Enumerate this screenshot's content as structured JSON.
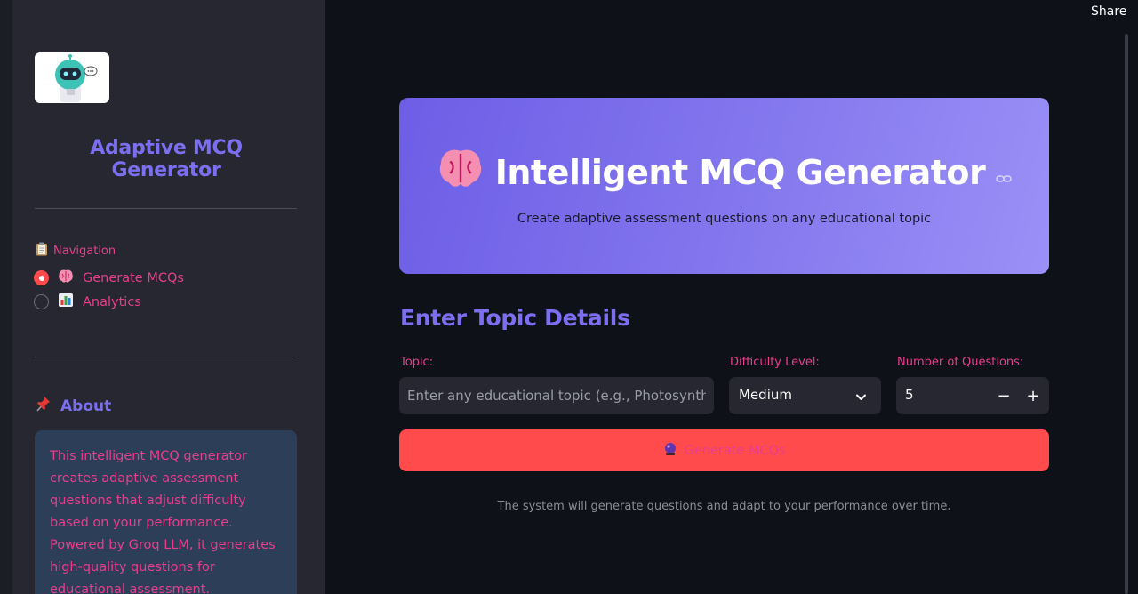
{
  "sidebar": {
    "title": "Adaptive MCQ Generator",
    "nav_label": "Navigation",
    "nav_items": [
      {
        "label": "Generate MCQs",
        "selected": true
      },
      {
        "label": "Analytics",
        "selected": false
      }
    ],
    "about_heading": "About",
    "about_text": "This intelligent MCQ generator creates adaptive assessment questions that adjust difficulty based on your performance. Powered by Groq LLM, it generates high-quality questions for educational assessment."
  },
  "header": {
    "share_label": "Share"
  },
  "hero": {
    "title": "Intelligent MCQ Generator",
    "subtitle": "Create adaptive assessment questions on any educational topic"
  },
  "form": {
    "section_title": "Enter Topic Details",
    "topic_label": "Topic:",
    "topic_placeholder": "Enter any educational topic (e.g., Photosynthesis, World War II, Calculus)",
    "topic_value": "",
    "difficulty_label": "Difficulty Level:",
    "difficulty_value": "Medium",
    "count_label": "Number of Questions:",
    "count_value": "5",
    "decrement": "−",
    "increment": "+",
    "generate_label": "Generate MCQs",
    "hint": "The system will generate questions and adapt to your performance over time."
  },
  "colors": {
    "accent": "#7b6ff0",
    "primary_button": "#ff4b4b",
    "label_pink": "#e83e8c",
    "background": "#0e1117",
    "sidebar": "#262730"
  },
  "icons": {
    "hero": "brain-icon",
    "nav_generate": "brain-icon",
    "nav_analytics": "bar-chart-icon",
    "navigation": "clipboard-icon",
    "about": "pushpin-icon",
    "generate_button": "crystal-ball-icon",
    "anchor": "link-icon",
    "select_arrow": "chevron-down-icon"
  }
}
